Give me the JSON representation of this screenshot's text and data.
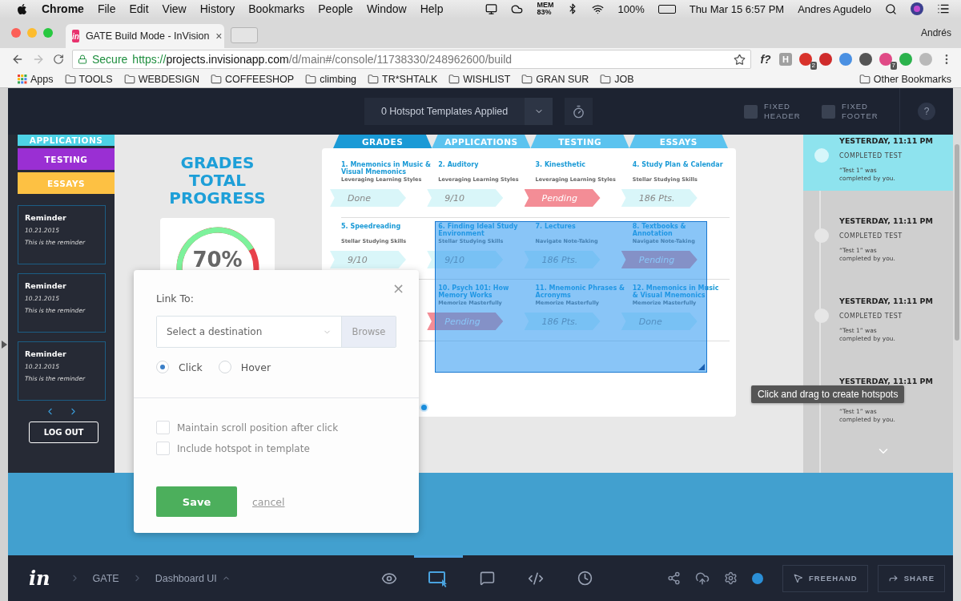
{
  "menubar": {
    "app": "Chrome",
    "menus": [
      "File",
      "Edit",
      "View",
      "History",
      "Bookmarks",
      "People",
      "Window",
      "Help"
    ],
    "mem_label": "MEM",
    "mem_value": "83%",
    "battery": "100%",
    "clock": "Thu Mar 15  6:57 PM",
    "user": "Andres Agudelo"
  },
  "browser": {
    "favicon": "in",
    "tab_title": "GATE Build Mode - InVision",
    "tab_close": "×",
    "profile": "Andrés",
    "secure": "Secure",
    "url": {
      "scheme": "https://",
      "host": "projects.invisionapp.com",
      "path": "/d/main#/console/11738330/248962600/build"
    },
    "extensions": [
      {
        "kind": "glyph",
        "glyph": "f?",
        "color": "#333333"
      },
      {
        "kind": "glyph",
        "glyph": "H",
        "color": "#a0a0a0"
      },
      {
        "kind": "badge",
        "badge": "2",
        "color": "#d8322b"
      },
      {
        "kind": "icon",
        "color": "#cf2b2b"
      },
      {
        "kind": "icon",
        "color": "#4a90e2"
      },
      {
        "kind": "icon",
        "color": "#555555"
      },
      {
        "kind": "badge",
        "badge": "7",
        "color": "#e04a86"
      },
      {
        "kind": "icon",
        "color": "#2bb24c"
      },
      {
        "kind": "icon",
        "color": "#b9b9b9"
      }
    ]
  },
  "bookmarks": {
    "apps": "Apps",
    "folders": [
      "TOOLS",
      "WEBDESIGN",
      "COFFEESHOP",
      "climbing",
      "TR*SHTALK",
      "WISHLIST",
      "GRAN SUR",
      "JOB"
    ],
    "other": "Other Bookmarks"
  },
  "toolbar": {
    "templates": "0 Hotspot Templates Applied",
    "toggles": [
      {
        "label": "FIXED HEADER",
        "checked": false
      },
      {
        "label": "FIXED FOOTER",
        "checked": false
      }
    ],
    "help": "?"
  },
  "prototype": {
    "side_tabs": [
      {
        "label": "APPLICATIONS",
        "color": "#4dd2e6"
      },
      {
        "label": "TESTING",
        "color": "#9a2fd3"
      },
      {
        "label": "ESSAYS",
        "color": "#fdc143"
      }
    ],
    "reminders": [
      {
        "title": "Reminder",
        "date": "10.21.2015",
        "text": "This is the reminder"
      },
      {
        "title": "Reminder",
        "date": "10.21.2015",
        "text": "This is the reminder"
      },
      {
        "title": "Reminder",
        "date": "10.21.2015",
        "text": "This is the reminder"
      }
    ],
    "logout": "LOG OUT",
    "heading": "GRADES TOTAL PROGRESS",
    "gauge": {
      "value": "70%"
    },
    "grid_tabs": [
      {
        "label": "GRADES",
        "selected": true
      },
      {
        "label": "APPLICATIONS",
        "selected": false
      },
      {
        "label": "TESTING",
        "selected": false
      },
      {
        "label": "ESSAYS",
        "selected": false
      }
    ],
    "rows": [
      {
        "cells": [
          {
            "title": "1. Mnemonics in Music & Visual Mnemonics",
            "subtitle": "Leveraging Learning Styles",
            "status": "Done",
            "kind": "normal"
          },
          {
            "title": "2. Auditory",
            "subtitle": "Leveraging Learning Styles",
            "status": "9/10",
            "kind": "normal"
          },
          {
            "title": "3. Kinesthetic",
            "subtitle": "Leveraging Learning Styles",
            "status": "Pending",
            "kind": "pending"
          },
          {
            "title": "4. Study Plan & Calendar",
            "subtitle": "Stellar Studying Skills",
            "status": "186 Pts.",
            "kind": "normal"
          }
        ]
      },
      {
        "cells": [
          {
            "title": "5. Speedreading",
            "subtitle": "Stellar Studying Skills",
            "status": "9/10",
            "kind": "normal"
          },
          {
            "title": "6. Finding Ideal Study Environment",
            "subtitle": "Stellar Studying Skills",
            "status": "9/10",
            "kind": "normal"
          },
          {
            "title": "7. Lectures",
            "subtitle": "Navigate Note-Taking",
            "status": "186 Pts.",
            "kind": "normal"
          },
          {
            "title": "8. Textbooks & Annotation",
            "subtitle": "Navigate Note-Taking",
            "status": "Pending",
            "kind": "pending"
          }
        ]
      },
      {
        "cells": [
          {
            "kind": "hidden"
          },
          {
            "title": "10. Psych 101: How Memory Works",
            "subtitle": "Memorize Masterfully",
            "status": "Pending",
            "kind": "pending"
          },
          {
            "title": "11. Mnemonic Phrases & Acronyms",
            "subtitle": "Memorize Masterfully",
            "status": "186 Pts.",
            "kind": "normal"
          },
          {
            "title": "12. Mnemonics in Music & Visual Mnemonics",
            "subtitle": "Memorize Masterfully",
            "status": "Done",
            "kind": "normal"
          }
        ]
      }
    ],
    "timeline": [
      {
        "time": "YESTERDAY, 11:11 PM",
        "event": "COMPLETED TEST",
        "text": "“Test 1” was completed by you.",
        "selected": true
      },
      {
        "time": "YESTERDAY, 11:11 PM",
        "event": "COMPLETED TEST",
        "text": "“Test 1” was completed by you.",
        "selected": false
      },
      {
        "time": "YESTERDAY, 11:11 PM",
        "event": "COMPLETED TEST",
        "text": "“Test 1” was completed by you.",
        "selected": false
      },
      {
        "time": "YESTERDAY, 11:11 PM",
        "text": "“Test 1” was completed by you."
      }
    ],
    "tooltip": "Click and drag to create hotspots"
  },
  "dialog": {
    "title": "Link To:",
    "close": "×",
    "destination_placeholder": "Select a destination",
    "browse": "Browse",
    "triggers": [
      {
        "label": "Click",
        "selected": true
      },
      {
        "label": "Hover",
        "selected": false
      }
    ],
    "options": [
      {
        "label": "Maintain scroll position after click",
        "checked": false
      },
      {
        "label": "Include hotspot in template",
        "checked": false
      }
    ],
    "save": "Save",
    "cancel": "cancel"
  },
  "bottom_bar": {
    "logo": "in",
    "breadcrumb": [
      "GATE",
      "Dashboard UI"
    ],
    "tools": [
      {
        "kind": "preview",
        "selected": false
      },
      {
        "kind": "build",
        "selected": true
      },
      {
        "kind": "comments",
        "selected": false
      },
      {
        "kind": "inspect",
        "selected": false
      },
      {
        "kind": "history",
        "selected": false
      }
    ],
    "actions": [
      {
        "kind": "freehand",
        "label": "FREEHAND"
      },
      {
        "kind": "share",
        "label": "SHARE"
      }
    ]
  }
}
